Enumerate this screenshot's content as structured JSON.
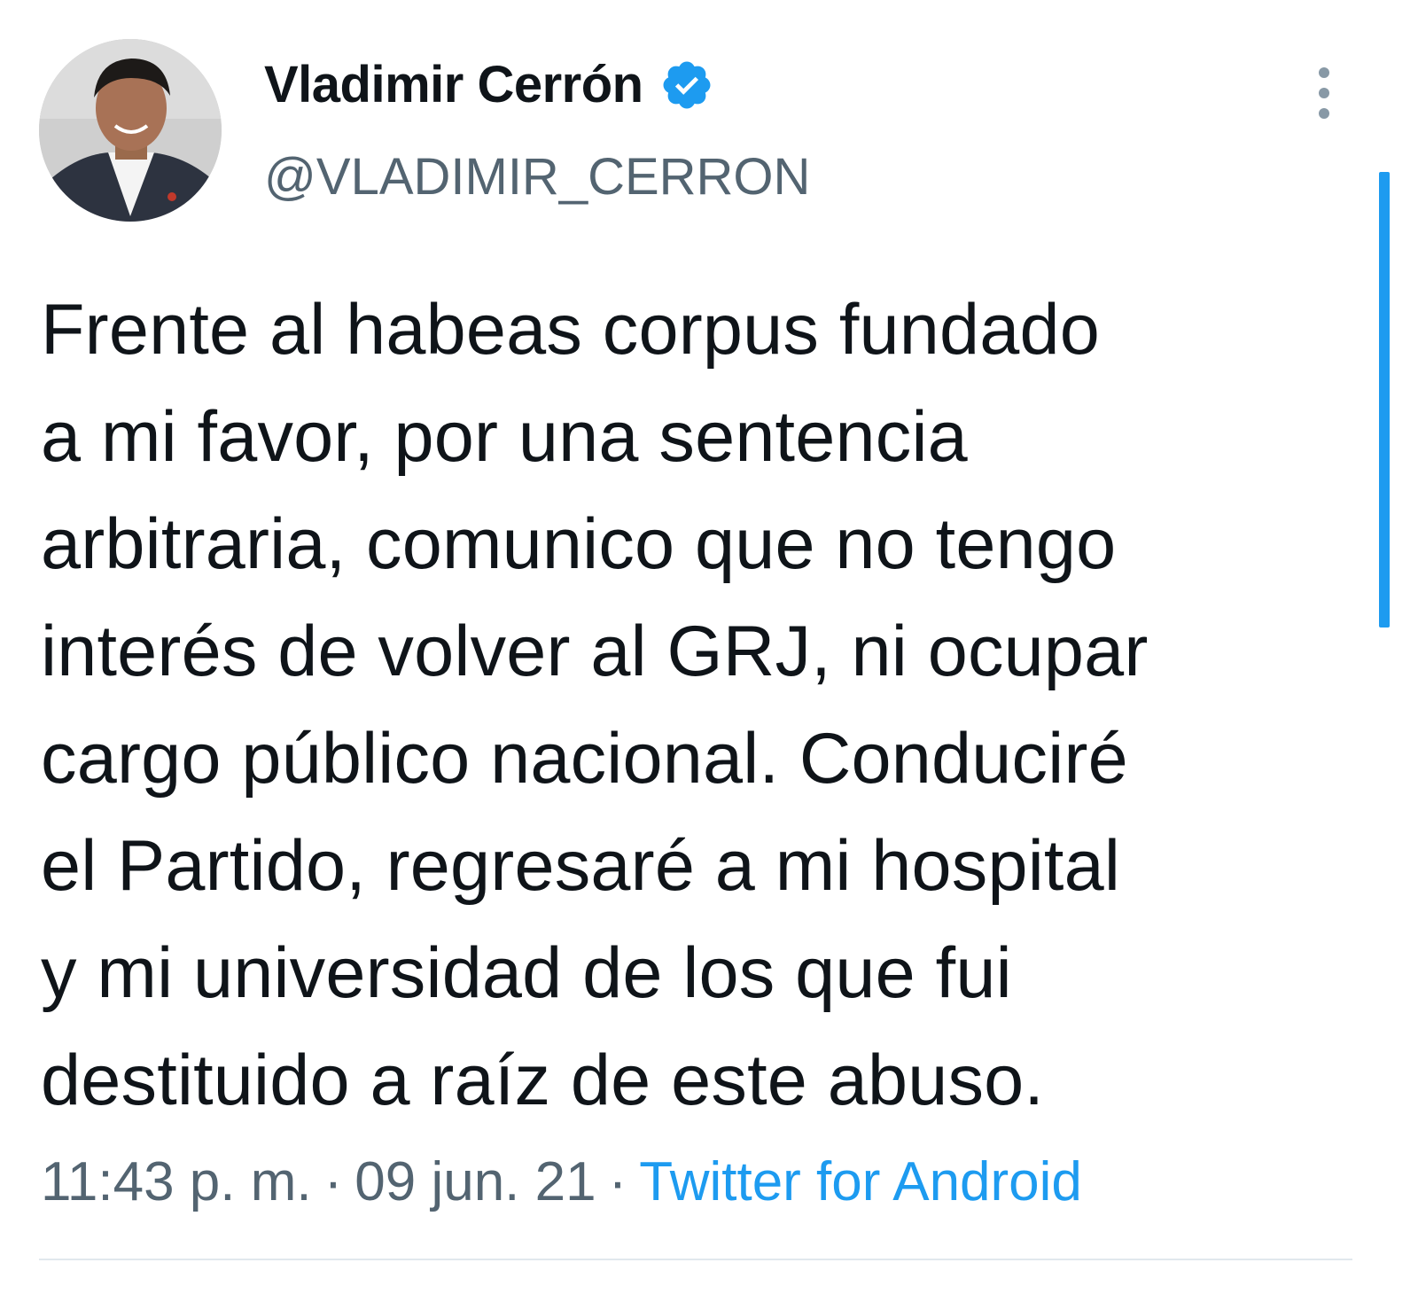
{
  "author": {
    "display_name": "Vladimir Cerrón",
    "handle": "@VLADIMIR_CERRON",
    "verified": true,
    "avatar_icon": "profile-photo-icon",
    "verified_icon": "verified-badge-icon"
  },
  "tweet": {
    "lines": [
      "Frente al habeas corpus fundado",
      "a mi favor, por una sentencia",
      "arbitraria, comunico que no tengo",
      "interés de volver al GRJ, ni ocupar",
      "cargo público nacional. Conduciré",
      "el Partido, regresaré a mi hospital",
      "y mi universidad de los que fui",
      "destituido a raíz de este abuso."
    ]
  },
  "meta": {
    "time": "11:43 p. m.",
    "separator": "·",
    "date": "09 jun. 21",
    "source": "Twitter for Android"
  },
  "colors": {
    "accent": "#1d9bf0",
    "secondary_text": "#536471",
    "primary_text": "#0f1419"
  },
  "more_icon": "more-vertical-icon"
}
